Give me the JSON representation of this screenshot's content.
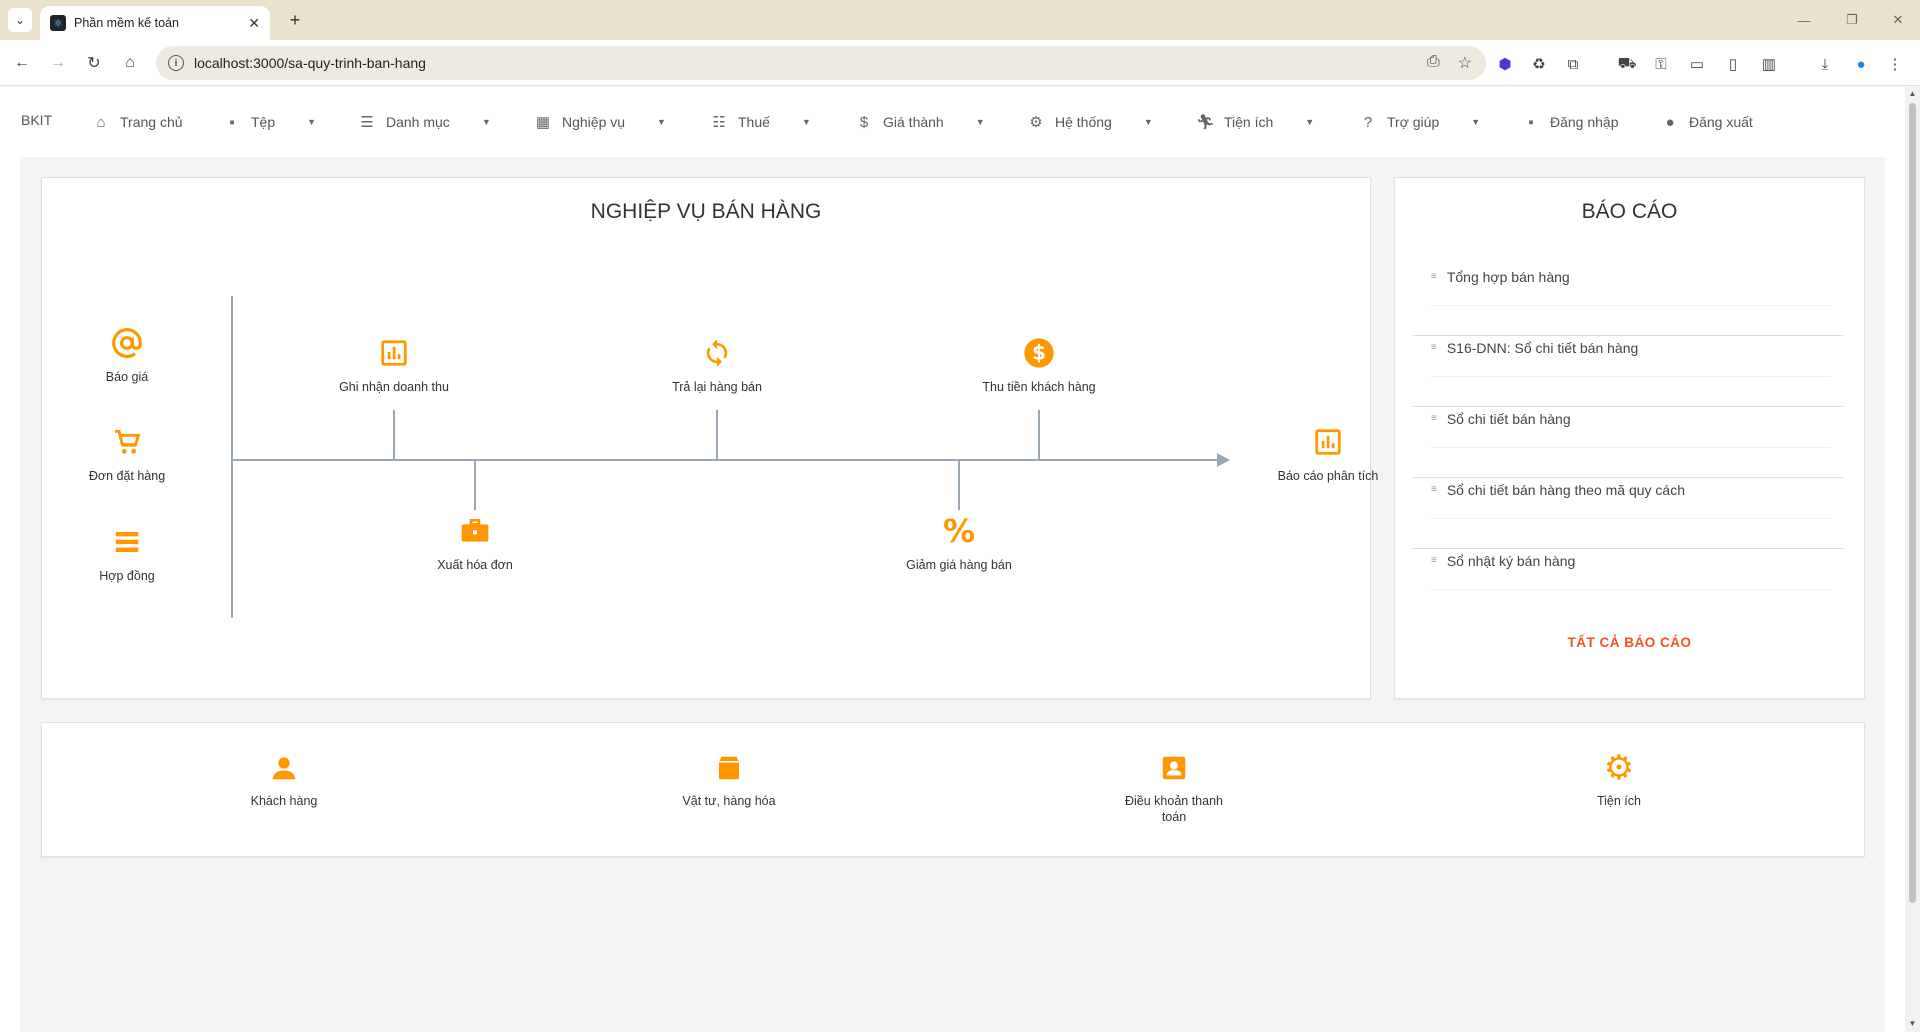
{
  "browser": {
    "tab_title": "Phần mềm kế toán",
    "url": "localhost:3000/sa-quy-trinh-ban-hang"
  },
  "menu": {
    "brand": "BKIT",
    "items": [
      {
        "label": "Trang chủ",
        "icon": "home-icon",
        "dropdown": false
      },
      {
        "label": "Tệp",
        "icon": "save-icon",
        "dropdown": true
      },
      {
        "label": "Danh mục",
        "icon": "list-icon",
        "dropdown": true
      },
      {
        "label": "Nghiệp vụ",
        "icon": "grid-icon",
        "dropdown": true
      },
      {
        "label": "Thuế",
        "icon": "checklist-icon",
        "dropdown": true
      },
      {
        "label": "Giá thành",
        "icon": "dollar-icon",
        "dropdown": true
      },
      {
        "label": "Hệ thống",
        "icon": "gear-icon",
        "dropdown": true
      },
      {
        "label": "Tiện ích",
        "icon": "run-icon",
        "dropdown": true
      },
      {
        "label": "Trợ giúp",
        "icon": "help-icon",
        "dropdown": true
      },
      {
        "label": "Đăng nhập",
        "icon": "lock-icon",
        "dropdown": false
      },
      {
        "label": "Đăng xuất",
        "icon": "circle-icon",
        "dropdown": false
      }
    ]
  },
  "process": {
    "title": "NGHIỆP VỤ BÁN HÀNG",
    "left": [
      {
        "label": "Báo giá",
        "icon": "at-icon"
      },
      {
        "label": "Đơn đặt hàng",
        "icon": "cart-icon"
      },
      {
        "label": "Hợp đồng",
        "icon": "menu-icon"
      }
    ],
    "top": [
      {
        "label": "Ghi nhận doanh thu",
        "icon": "bar-chart-icon"
      },
      {
        "label": "Trả lại hàng bán",
        "icon": "refresh-icon"
      },
      {
        "label": "Thu tiền khách hàng",
        "icon": "dollar-circle-icon"
      }
    ],
    "bottom": [
      {
        "label": "Xuất hóa đơn",
        "icon": "briefcase-icon"
      },
      {
        "label": "Giảm giá hàng bán",
        "icon": "percent-icon"
      }
    ],
    "end": {
      "label": "Báo cáo phân tích",
      "icon": "bar-chart-icon"
    }
  },
  "reports": {
    "title": "BÁO CÁO",
    "items": [
      "Tổng hợp bán hàng",
      "S16-DNN: Sổ chi tiết bán hàng",
      "Sổ chi tiết bán hàng",
      "Sổ chi tiết bán hàng theo mã quy cách",
      "Sổ nhật ký bán hàng"
    ],
    "all_label": "TẤT CẢ BÁO CÁO"
  },
  "bottom": [
    {
      "label": "Khách hàng",
      "icon": "person-icon"
    },
    {
      "label": "Vật tư, hàng hóa",
      "icon": "box-icon"
    },
    {
      "label": "Điều khoản thanh toán",
      "icon": "contact-icon"
    },
    {
      "label": "Tiện ích",
      "icon": "gear-icon"
    }
  ],
  "colors": {
    "accent": "#ff9800",
    "link": "#f4511e"
  }
}
